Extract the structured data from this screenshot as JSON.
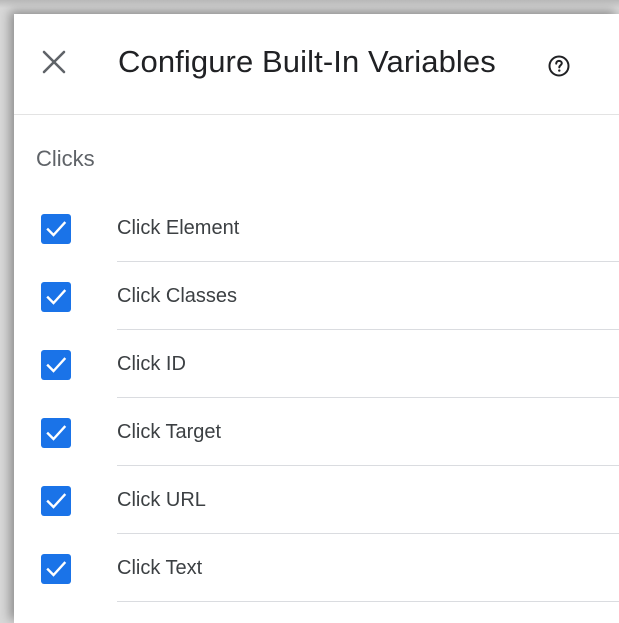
{
  "dialog": {
    "title": "Configure Built-In Variables",
    "close_icon": "close-icon",
    "help_icon": "help-circle-icon"
  },
  "section": {
    "title": "Clicks",
    "items": [
      {
        "label": "Click Element",
        "checked": true
      },
      {
        "label": "Click Classes",
        "checked": true
      },
      {
        "label": "Click ID",
        "checked": true
      },
      {
        "label": "Click Target",
        "checked": true
      },
      {
        "label": "Click URL",
        "checked": true
      },
      {
        "label": "Click Text",
        "checked": true
      }
    ]
  },
  "colors": {
    "checkbox": "#1a73e8",
    "title_text": "#202124",
    "section_text": "#5f6368"
  }
}
